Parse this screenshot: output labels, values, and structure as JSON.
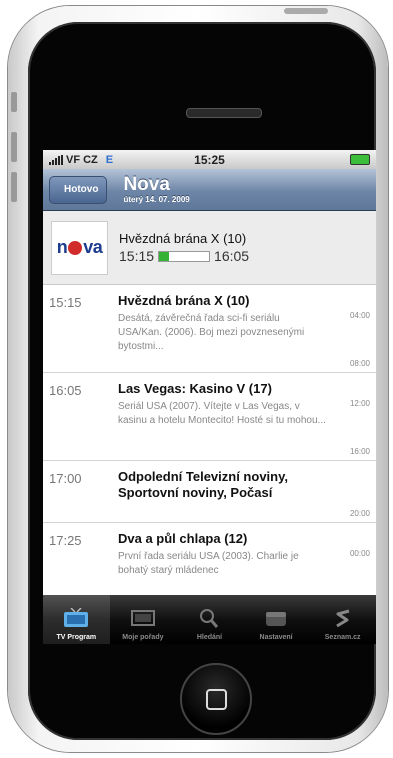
{
  "status_bar": {
    "carrier": "VF CZ",
    "network": "E",
    "time": "15:25"
  },
  "nav": {
    "back_label": "Hotovo",
    "title": "Nova",
    "subtitle": "úterý 14. 07. 2009"
  },
  "now_playing": {
    "logo_text": "nova",
    "title": "Hvězdná brána X (10)",
    "start": "15:15",
    "end": "16:05",
    "progress": 0.2
  },
  "programs": [
    {
      "time": "15:15",
      "title": "Hvězdná brána X (10)",
      "description": "Desátá, závěrečná řada sci-fi seriálu USA/Kan. (2006). Boj mezi povznesenými bytostmi...",
      "start_label": "04:00",
      "end_label": "08:00"
    },
    {
      "time": "16:05",
      "title": "Las Vegas: Kasino V (17)",
      "description": "Seriál USA (2007). Vítejte v Las Vegas, v kasinu a hotelu Montecito! Hosté si tu mohou...",
      "start_label": "12:00",
      "end_label": "16:00"
    },
    {
      "time": "17:00",
      "title": "Odpolední Televizní noviny, Sportovní noviny, Počasí",
      "description": "",
      "start_label": "",
      "end_label": "20:00"
    },
    {
      "time": "17:25",
      "title": "Dva a půl chlapa (12)",
      "description": "První řada seriálu USA (2003). Charlie je bohatý starý mládenec",
      "start_label": "00:00",
      "end_label": ""
    }
  ],
  "tabs": [
    {
      "label": "TV Program",
      "icon": "tv-icon",
      "active": true
    },
    {
      "label": "Moje pořady",
      "icon": "screen-icon",
      "active": false
    },
    {
      "label": "Hledání",
      "icon": "search-icon",
      "active": false
    },
    {
      "label": "Nastavení",
      "icon": "settings-icon",
      "active": false
    },
    {
      "label": "Seznam.cz",
      "icon": "seznam-icon",
      "active": false
    }
  ]
}
